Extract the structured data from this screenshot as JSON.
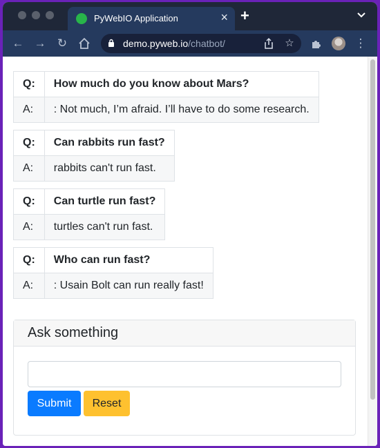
{
  "browser": {
    "tab_title": "PyWebIO Application",
    "url_domain": "demo.pyweb.io",
    "url_path": "/chatbot/"
  },
  "conversation": [
    {
      "q_label": "Q:",
      "question": "How much do you know about Mars?",
      "a_label": "A:",
      "answer": ": Not much, I’m afraid. I’ll have to do some research."
    },
    {
      "q_label": "Q:",
      "question": "Can rabbits run fast?",
      "a_label": "A:",
      "answer": "rabbits can't run fast."
    },
    {
      "q_label": "Q:",
      "question": "Can turtle run fast?",
      "a_label": "A:",
      "answer": "turtles can't run fast."
    },
    {
      "q_label": "Q:",
      "question": "Who can run fast?",
      "a_label": "A:",
      "answer": ": Usain Bolt can run really fast!"
    }
  ],
  "ask_form": {
    "title": "Ask something",
    "input_value": "",
    "submit_label": "Submit",
    "reset_label": "Reset"
  },
  "colors": {
    "submit": "#0a7bff",
    "reset": "#fec12f",
    "browser_toolbar": "#253a5e"
  }
}
